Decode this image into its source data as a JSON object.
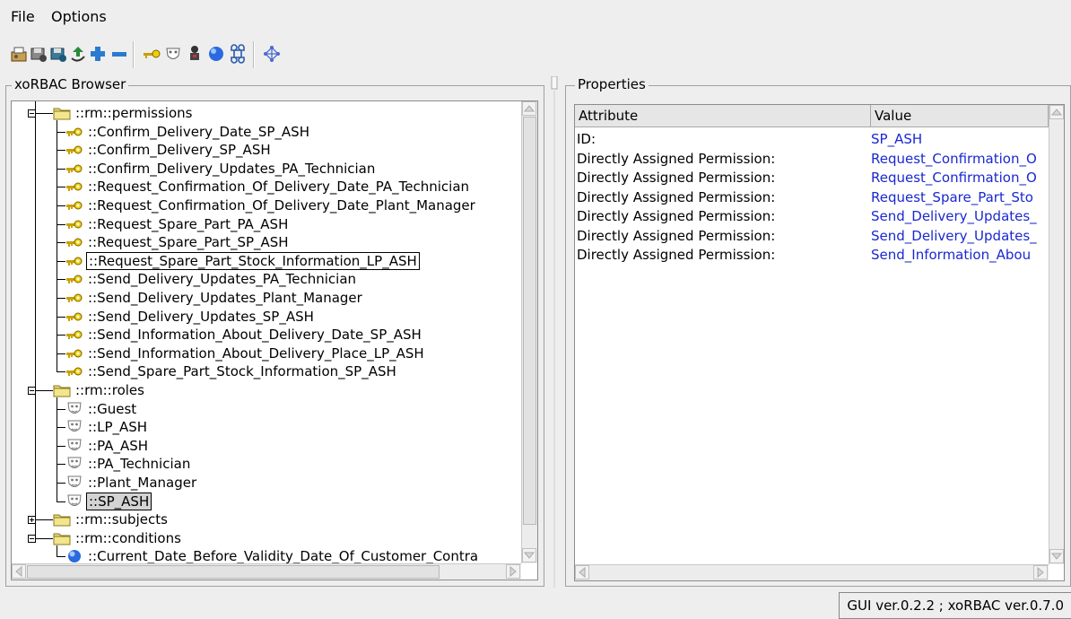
{
  "menu": {
    "file": "File",
    "options": "Options"
  },
  "toolbar": {
    "icons": [
      "open-icon",
      "save-icon",
      "save-as-icon",
      "refresh-icon",
      "add-icon",
      "remove-icon",
      "permission-key-icon",
      "role-mask-icon",
      "subject-person-icon",
      "condition-globe-icon",
      "command-icon",
      "network-icon"
    ]
  },
  "browser": {
    "title": "xoRBAC Browser",
    "permissions_group": "::rm::permissions",
    "permissions": [
      "::Confirm_Delivery_Date_SP_ASH",
      "::Confirm_Delivery_SP_ASH",
      "::Confirm_Delivery_Updates_PA_Technician",
      "::Request_Confirmation_Of_Delivery_Date_PA_Technician",
      "::Request_Confirmation_Of_Delivery_Date_Plant_Manager",
      "::Request_Spare_Part_PA_ASH",
      "::Request_Spare_Part_SP_ASH",
      "::Request_Spare_Part_Stock_Information_LP_ASH",
      "::Send_Delivery_Updates_PA_Technician",
      "::Send_Delivery_Updates_Plant_Manager",
      "::Send_Delivery_Updates_SP_ASH",
      "::Send_Information_About_Delivery_Date_SP_ASH",
      "::Send_Information_About_Delivery_Place_LP_ASH",
      "::Send_Spare_Part_Stock_Information_SP_ASH"
    ],
    "roles_group": "::rm::roles",
    "roles": [
      "::Guest",
      "::LP_ASH",
      "::PA_ASH",
      "::PA_Technician",
      "::Plant_Manager",
      "::SP_ASH"
    ],
    "subjects_group": "::rm::subjects",
    "conditions_group": "::rm::conditions",
    "conditions": [
      "::Current_Date_Before_Validity_Date_Of_Customer_Contra"
    ]
  },
  "properties": {
    "title": "Properties",
    "col_attribute": "Attribute",
    "col_value": "Value",
    "rows": [
      {
        "attr": "ID:",
        "value": "SP_ASH"
      },
      {
        "attr": "Directly Assigned Permission:",
        "value": "Request_Confirmation_O"
      },
      {
        "attr": "Directly Assigned Permission:",
        "value": "Request_Confirmation_O"
      },
      {
        "attr": "Directly Assigned Permission:",
        "value": "Request_Spare_Part_Sto"
      },
      {
        "attr": "Directly Assigned Permission:",
        "value": "Send_Delivery_Updates_"
      },
      {
        "attr": "Directly Assigned Permission:",
        "value": "Send_Delivery_Updates_"
      },
      {
        "attr": "Directly Assigned Permission:",
        "value": "Send_Information_Abou"
      }
    ]
  },
  "status": "GUI ver.0.2.2 ; xoRBAC ver.0.7.0",
  "colors": {
    "link": "#1a28d0",
    "selection": "#d3d3d3"
  }
}
